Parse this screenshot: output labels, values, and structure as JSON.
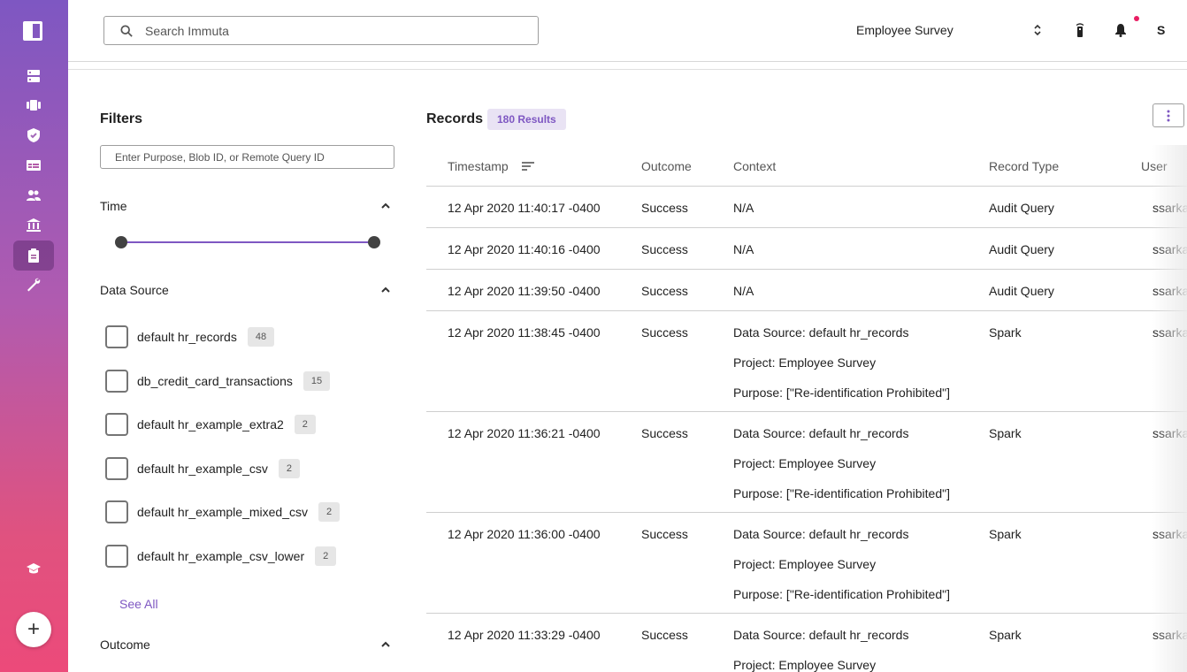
{
  "header": {
    "search_placeholder": "Search Immuta",
    "project": "Employee Survey",
    "user_initial": "S"
  },
  "filters": {
    "title": "Filters",
    "input_placeholder": "Enter Purpose, Blob ID, or Remote Query ID",
    "time_label": "Time",
    "data_source_label": "Data Source",
    "data_sources": [
      {
        "label": "default hr_records",
        "count": "48"
      },
      {
        "label": "db_credit_card_transactions",
        "count": "15"
      },
      {
        "label": "default hr_example_extra2",
        "count": "2"
      },
      {
        "label": "default hr_example_csv",
        "count": "2"
      },
      {
        "label": "default hr_example_mixed_csv",
        "count": "2"
      },
      {
        "label": "default hr_example_csv_lower",
        "count": "2"
      }
    ],
    "see_all": "See All",
    "outcome_label": "Outcome"
  },
  "records": {
    "title": "Records",
    "results": "180 Results",
    "columns": [
      "Timestamp",
      "Outcome",
      "Context",
      "Record Type",
      "User"
    ],
    "rows": [
      {
        "timestamp": "12 Apr 2020 11:40:17 -0400",
        "outcome": "Success",
        "context": [
          "N/A"
        ],
        "type": "Audit Query",
        "user": "ssarkar"
      },
      {
        "timestamp": "12 Apr 2020 11:40:16 -0400",
        "outcome": "Success",
        "context": [
          "N/A"
        ],
        "type": "Audit Query",
        "user": "ssarkar"
      },
      {
        "timestamp": "12 Apr 2020 11:39:50 -0400",
        "outcome": "Success",
        "context": [
          "N/A"
        ],
        "type": "Audit Query",
        "user": "ssarkar"
      },
      {
        "timestamp": "12 Apr 2020 11:38:45 -0400",
        "outcome": "Success",
        "context": [
          "Data Source: default hr_records",
          "Project: Employee Survey",
          "Purpose: [\"Re-identification Prohibited\"]"
        ],
        "type": "Spark",
        "user": "ssarkar"
      },
      {
        "timestamp": "12 Apr 2020 11:36:21 -0400",
        "outcome": "Success",
        "context": [
          "Data Source: default hr_records",
          "Project: Employee Survey",
          "Purpose: [\"Re-identification Prohibited\"]"
        ],
        "type": "Spark",
        "user": "ssarkar"
      },
      {
        "timestamp": "12 Apr 2020 11:36:00 -0400",
        "outcome": "Success",
        "context": [
          "Data Source: default hr_records",
          "Project: Employee Survey",
          "Purpose: [\"Re-identification Prohibited\"]"
        ],
        "type": "Spark",
        "user": "ssarkar"
      },
      {
        "timestamp": "12 Apr 2020 11:33:29 -0400",
        "outcome": "Success",
        "context": [
          "Data Source: default hr_records",
          "Project: Employee Survey"
        ],
        "type": "Spark",
        "user": "ssarkar"
      }
    ]
  },
  "sidebar": {
    "icons": [
      "data-sources-icon",
      "projects-icon",
      "policies-icon",
      "query-editor-icon",
      "people-icon",
      "governance-icon",
      "audit-icon",
      "app-settings-icon",
      "learn-icon"
    ],
    "active": "audit-icon"
  },
  "colors": {
    "accent": "#7e57c2",
    "notification": "#e91e63"
  }
}
